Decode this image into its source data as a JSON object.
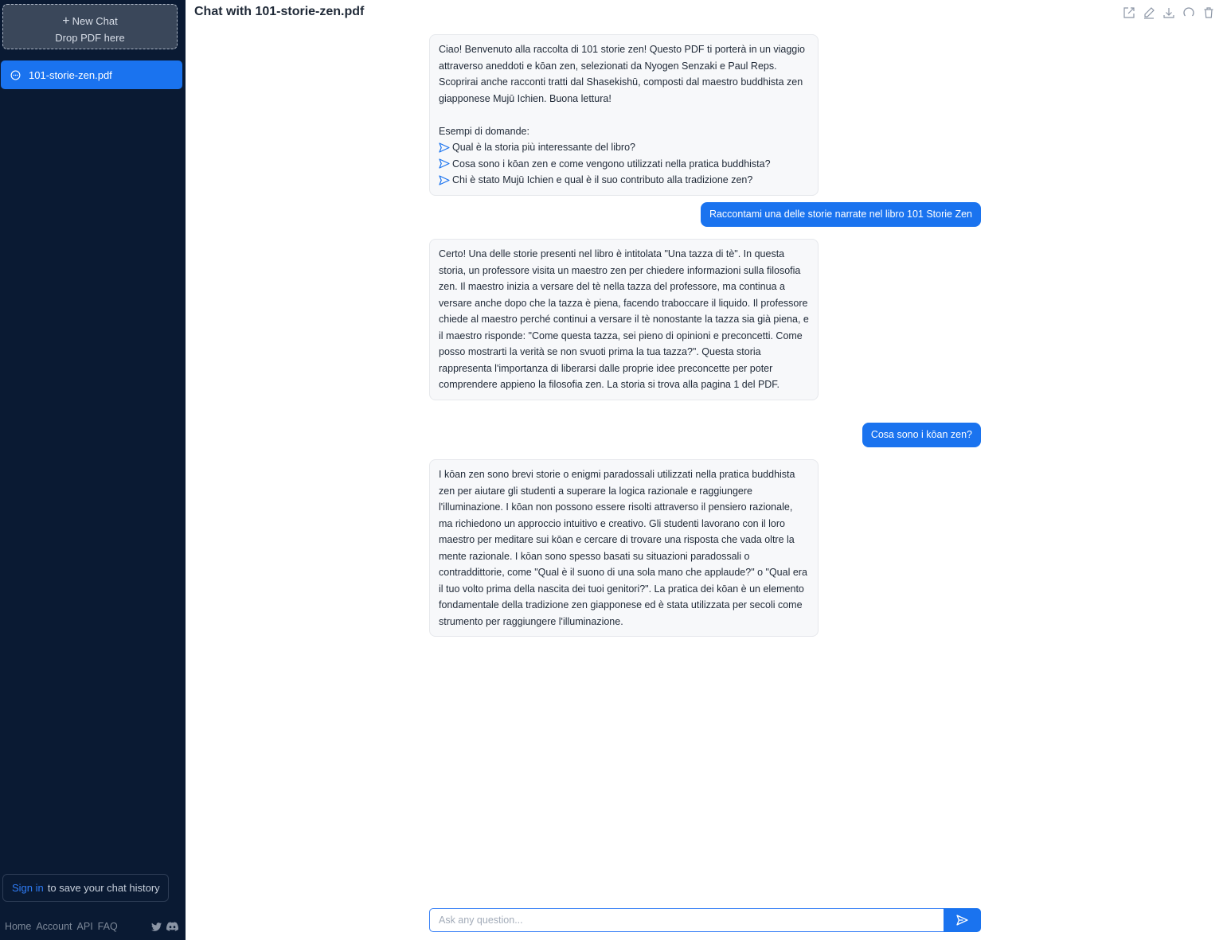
{
  "sidebar": {
    "new_chat_label": "New Chat",
    "drop_label": "Drop PDF here",
    "chat_items": [
      {
        "label": "101-storie-zen.pdf"
      }
    ],
    "signin_link": "Sign in",
    "signin_text": "to save your chat history",
    "footer_links": [
      "Home",
      "Account",
      "API",
      "FAQ"
    ],
    "social_icons": [
      "twitter-icon",
      "discord-icon"
    ]
  },
  "header": {
    "title": "Chat with 101-storie-zen.pdf",
    "toolbar_icons": [
      "share-icon",
      "edit-icon",
      "download-icon",
      "refresh-icon",
      "trash-icon"
    ]
  },
  "messages": {
    "welcome": {
      "intro": "Ciao! Benvenuto alla raccolta di 101 storie zen! Questo PDF ti porterà in un viaggio attraverso aneddoti e kōan zen, selezionati da Nyogen Senzaki e Paul Reps. Scoprirai anche racconti tratti dal Shasekishū, composti dal maestro buddhista zen giapponese Mujū Ichien. Buona lettura!",
      "examples_title": "Esempi di domande:",
      "examples": [
        "Qual è la storia più interessante del libro?",
        "Cosa sono i kōan zen e come vengono utilizzati nella pratica buddhista?",
        "Chi è stato Mujū Ichien e qual è il suo contributo alla tradizione zen?"
      ]
    },
    "user1": "Raccontami una delle storie narrate nel libro 101 Storie Zen",
    "bot1": "Certo! Una delle storie presenti nel libro è intitolata \"Una tazza di tè\". In questa storia, un professore visita un maestro zen per chiedere informazioni sulla filosofia zen. Il maestro inizia a versare del tè nella tazza del professore, ma continua a versare anche dopo che la tazza è piena, facendo traboccare il liquido. Il professore chiede al maestro perché continui a versare il tè nonostante la tazza sia già piena, e il maestro risponde: \"Come questa tazza, sei pieno di opinioni e preconcetti. Come posso mostrarti la verità se non svuoti prima la tua tazza?\". Questa storia rappresenta l'importanza di liberarsi dalle proprie idee preconcette per poter comprendere appieno la filosofia zen. La storia si trova alla pagina 1 del PDF.",
    "user2": "Cosa sono i kōan zen?",
    "bot2": "I kōan zen sono brevi storie o enigmi paradossali utilizzati nella pratica buddhista zen per aiutare gli studenti a superare la logica razionale e raggiungere l'illuminazione. I kōan non possono essere risolti attraverso il pensiero razionale, ma richiedono un approccio intuitivo e creativo. Gli studenti lavorano con il loro maestro per meditare sui kōan e cercare di trovare una risposta che vada oltre la mente razionale. I kōan sono spesso basati su situazioni paradossali o contraddittorie, come \"Qual è il suono di una sola mano che applaude?\" o \"Qual era il tuo volto prima della nascita dei tuoi genitori?\". La pratica dei kōan è un elemento fondamentale della tradizione zen giapponese ed è stata utilizzata per secoli come strumento per raggiungere l'illuminazione."
  },
  "input": {
    "placeholder": "Ask any question..."
  },
  "colors": {
    "sidebar_bg": "#0a1a33",
    "accent": "#1a73ef"
  }
}
